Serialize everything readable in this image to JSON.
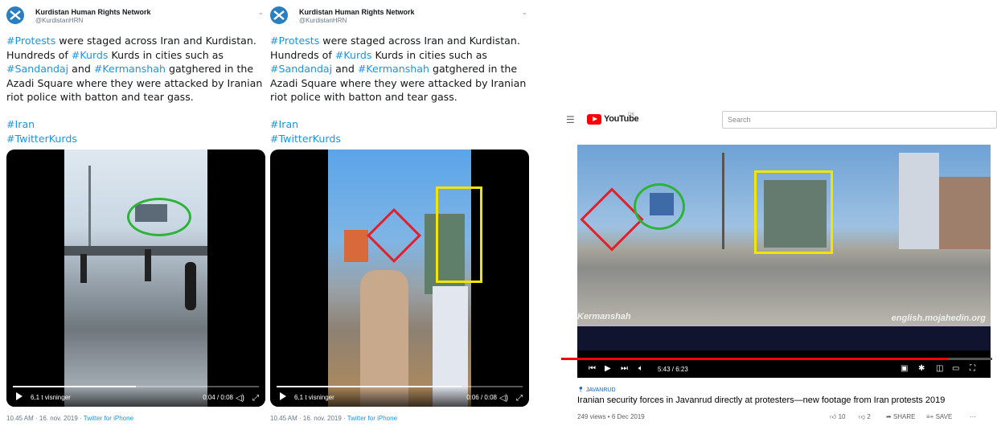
{
  "tweets": [
    {
      "account_name": "Kurdistan Human Rights Network",
      "handle": "@KurdistanHRN",
      "text_segments": [
        {
          "t": "#Protests",
          "h": true
        },
        {
          "t": " were staged across Iran and Kurdistan. Hundreds of ",
          "h": false
        },
        {
          "t": "#Kurds",
          "h": true
        },
        {
          "t": " Kurds in cities such as ",
          "h": false
        },
        {
          "t": "#Sandandaj",
          "h": true
        },
        {
          "t": " and ",
          "h": false
        },
        {
          "t": "#Kermanshah",
          "h": true
        },
        {
          "t": " gatghered in the Azadi Square where they were attacked by Iranian riot police with batton and tear gass.",
          "h": false
        }
      ],
      "hashtags": [
        "#Iran",
        "#TwitterKurds"
      ],
      "video": {
        "views": "6,1 t visninger",
        "time": "0:04 / 0:08",
        "progress": 0.5
      },
      "timestamp": "10.45 AM · 16. nov. 2019 · ",
      "source": "Twitter for iPhone"
    },
    {
      "account_name": "Kurdistan Human Rights Network",
      "handle": "@KurdistanHRN",
      "text_segments": [
        {
          "t": "#Protests",
          "h": true
        },
        {
          "t": " were staged across Iran and Kurdistan. Hundreds of ",
          "h": false
        },
        {
          "t": "#Kurds",
          "h": true
        },
        {
          "t": " Kurds in cities such as ",
          "h": false
        },
        {
          "t": "#Sandandaj",
          "h": true
        },
        {
          "t": " and ",
          "h": false
        },
        {
          "t": "#Kermanshah",
          "h": true
        },
        {
          "t": " gatghered in the Azadi Square where they were attacked by Iranian riot police with batton and tear gass.",
          "h": false
        }
      ],
      "hashtags": [
        "#Iran",
        "#TwitterKurds"
      ],
      "video": {
        "views": "6,1 t visninger",
        "time": "0:06 / 0:08",
        "progress": 0.75
      },
      "timestamp": "10.45 AM · 16. nov. 2019 · ",
      "source": "Twitter for iPhone"
    }
  ],
  "youtube": {
    "logo_text": "YouTube",
    "region": "DK",
    "search_placeholder": "Search",
    "overlay_left": "Kermanshah",
    "overlay_right": "english.mojahedin.org",
    "time": "5:43 / 6:23",
    "progress": 0.9,
    "channel": "JAVANRUD",
    "title": "Iranian security forces in Javanrud directly at protesters—new footage from Iran protests 2019",
    "meta": "249 views • 6 Dec 2019",
    "likes": "10",
    "dislikes": "2",
    "share": "SHARE",
    "save": "SAVE"
  },
  "colors": {
    "annotation_green": "#2db33a",
    "annotation_yellow": "#f2e600",
    "annotation_red": "#e0202a",
    "link": "#1b95e0",
    "yt_red": "#ff0000"
  }
}
